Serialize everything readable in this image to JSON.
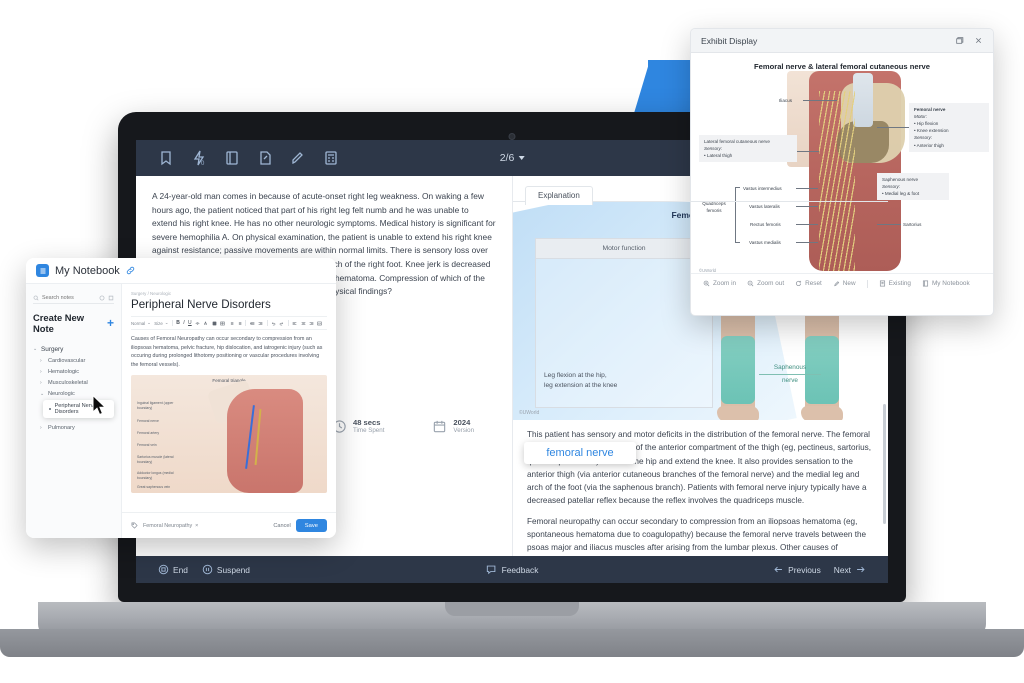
{
  "background": {
    "accent_blue": "#2f86e0"
  },
  "qbank": {
    "toolbar": {
      "icons": [
        "bookmark-icon",
        "lab-values-icon",
        "notebook-icon",
        "note-icon",
        "highlighter-icon",
        "calculator-icon"
      ],
      "page_indicator": "2/6"
    },
    "question": {
      "stem": "A 24-year-old man comes in because of acute-onset right leg weakness.  On waking a few hours ago, the patient noticed that part of his right leg felt numb and he was unable to extend his right knee.  He has no other neurologic symptoms.  Medical history is significant for severe hemophilia A.  On physical examination, the patient is unable to extend his right knee against resistance; passive movements are within normal limits.  There is sensory loss over the anterior and medial thigh, medial shin, and arch of the right foot.  Knee jerk is decreased on the right side.  Imaging reveals a spontaneous hematoma.  Compression of which of the following structures best explains this patient's physical findings?"
    },
    "stats": [
      {
        "icon": "clock-icon",
        "value": "48 secs",
        "label": "Time Spent"
      },
      {
        "icon": "calendar-icon",
        "value": "2024",
        "label": "Version"
      }
    ],
    "explanation": {
      "tab_label": "Explanation",
      "figure": {
        "title": "Femoral nerve",
        "motor_header": "Motor function",
        "motor_text": "Leg flexion at the hip,\nleg extension at the knee",
        "saphenous_label_1": "Saphenous",
        "saphenous_label_2": "nerve",
        "watermark": "©UWorld"
      },
      "popup_term": "femoral nerve",
      "paragraphs": [
        "This patient has sensory and motor deficits in the distribution of the femoral nerve.  The femoral nerve innervates the muscles of the anterior compartment of the thigh (eg, pectineus, sartorius, quadriceps femoris) that flex the hip and extend the knee.  It also provides sensation to the anterior thigh (via anterior cutaneous branches of the femoral nerve) and the medial leg and arch of the foot (via the saphenous branch).  Patients with femoral nerve injury typically have a decreased patellar reflex because the reflex involves the quadriceps muscle.",
        "Femoral neuropathy can occur secondary to compression from an iliopsoas hematoma (eg, spontaneous hematoma due to coagulopathy) because the femoral nerve travels between the psoas major and iliacus muscles after arising from the lumbar plexus.  Other causes of"
      ]
    },
    "bottom_bar": {
      "left": [
        {
          "icon": "stop-icon",
          "label": "End"
        },
        {
          "icon": "pause-icon",
          "label": "Suspend"
        }
      ],
      "center": {
        "icon": "feedback-icon",
        "label": "Feedback"
      },
      "right": [
        {
          "icon": "arrow-left-icon",
          "label": "Previous"
        },
        {
          "icon": "arrow-right-icon",
          "label": "Next"
        }
      ]
    }
  },
  "notebook": {
    "window_title": "My Notebook",
    "logo_icon": "notebook-logo-icon",
    "link_icon": "link-icon",
    "search": {
      "placeholder": "Search notes",
      "icon": "search-icon",
      "right_icons": [
        "filter-icon",
        "collapse-icon"
      ]
    },
    "create_label": "Create New Note",
    "plus_label": "+",
    "tree": [
      {
        "label": "Surgery",
        "level": 0,
        "expanded": true
      },
      {
        "label": "Cardiovascular",
        "level": 1,
        "expanded": false
      },
      {
        "label": "Hematologic",
        "level": 1,
        "expanded": false
      },
      {
        "label": "Musculoskeletal",
        "level": 1,
        "expanded": false
      },
      {
        "label": "Neurologic",
        "level": 1,
        "expanded": true
      },
      {
        "label": "Peripheral Nerve Disorders",
        "level": 2,
        "selected": true
      },
      {
        "label": "Pulmonary",
        "level": 1,
        "expanded": false
      }
    ],
    "editor": {
      "breadcrumb": "Surgery / Neurologic",
      "title": "Peripheral Nerve Disorders",
      "format_style": "Normal",
      "format_size": "Size",
      "body": "Causes of Femoral Neuropathy can occur secondary to compression from an iliopsoas hematoma, pelvic fracture, hip dislocation, and iatrogenic injury (such as occuring during prolonged lithotomy positioning or vascular procedures involving the femoral vessels).",
      "figure_caption": "Femoral triangle",
      "figure_labels": [
        "Inguinal ligament (upper boundary)",
        "Femoral nerve",
        "Femoral artery",
        "Femoral vein",
        "Sartorius muscle (lateral boundary)",
        "Adductor longus (medial boundary)",
        "Great saphenous vein"
      ]
    },
    "footer": {
      "tag_icon": "tag-icon",
      "tag": "Femoral Neuropathy",
      "tag_remove": "×",
      "cancel_label": "Cancel",
      "save_label": "Save"
    },
    "cursor_icon": "mouse-cursor-icon"
  },
  "exhibit": {
    "window_title": "Exhibit Display",
    "window_actions": [
      "restore-icon",
      "close-icon"
    ],
    "title": "Femoral nerve & lateral femoral cutaneous nerve",
    "watermark": "©UWorld",
    "labels": {
      "iliacus": "Iliacus",
      "femoral_nerve_title": "Femoral nerve",
      "femoral_motor": "Motor:",
      "femoral_motor_items": [
        "Hip flexion",
        "Knee extension"
      ],
      "femoral_sensory": "Sensory:",
      "femoral_sensory_items": [
        "Anterior thigh"
      ],
      "lfcn_title": "Lateral femoral cutaneous nerve",
      "lfcn_sensory": "Sensory:",
      "lfcn_sensory_items": [
        "Lateral thigh"
      ],
      "saphenous_title": "Saphenous nerve",
      "saphenous_sensory": "Sensory:",
      "saphenous_sensory_items": [
        "Medial leg & foot"
      ],
      "quadriceps": "Quadriceps\nfemoris",
      "quad_items": [
        "Vastus intermedius",
        "Vastus lateralis",
        "Rectus femoris",
        "Vastus medialis"
      ],
      "sartorius": "Sartorius"
    },
    "tools": [
      {
        "icon": "zoom-in-icon",
        "label": "Zoom in"
      },
      {
        "icon": "zoom-out-icon",
        "label": "Zoom out"
      },
      {
        "icon": "reset-icon",
        "label": "Reset"
      },
      {
        "icon": "new-note-icon",
        "label": "New"
      },
      {
        "icon": "existing-note-icon",
        "label": "Existing"
      },
      {
        "icon": "notebook-icon",
        "label": "My Notebook"
      }
    ]
  }
}
